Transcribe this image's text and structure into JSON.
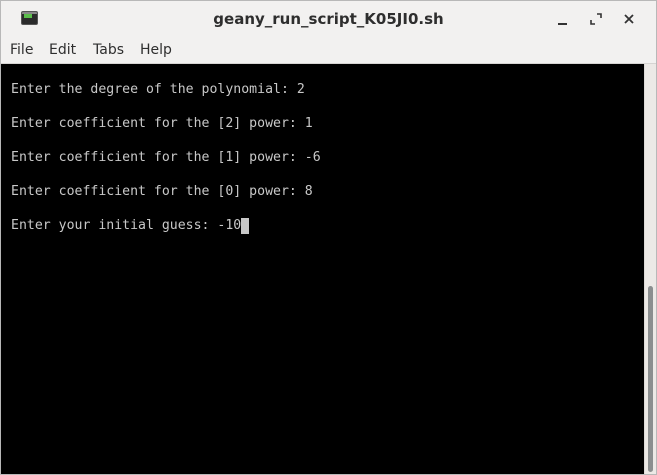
{
  "window": {
    "title": "geany_run_script_K05JI0.sh",
    "app_icon": "terminal-icon",
    "controls": {
      "minimize_icon": "minimize-icon",
      "maximize_icon": "maximize-icon",
      "close_icon": "close-icon"
    }
  },
  "menubar": {
    "items": [
      {
        "label": "File"
      },
      {
        "label": "Edit"
      },
      {
        "label": "Tabs"
      },
      {
        "label": "Help"
      }
    ]
  },
  "terminal": {
    "lines": [
      "Enter the degree of the polynomial: 2",
      "Enter coefficient for the [2] power: 1",
      "Enter coefficient for the [1] power: -6",
      "Enter coefficient for the [0] power: 8",
      "Enter your initial guess: -10"
    ],
    "background": "#000000",
    "foreground": "#c8c8c8"
  }
}
